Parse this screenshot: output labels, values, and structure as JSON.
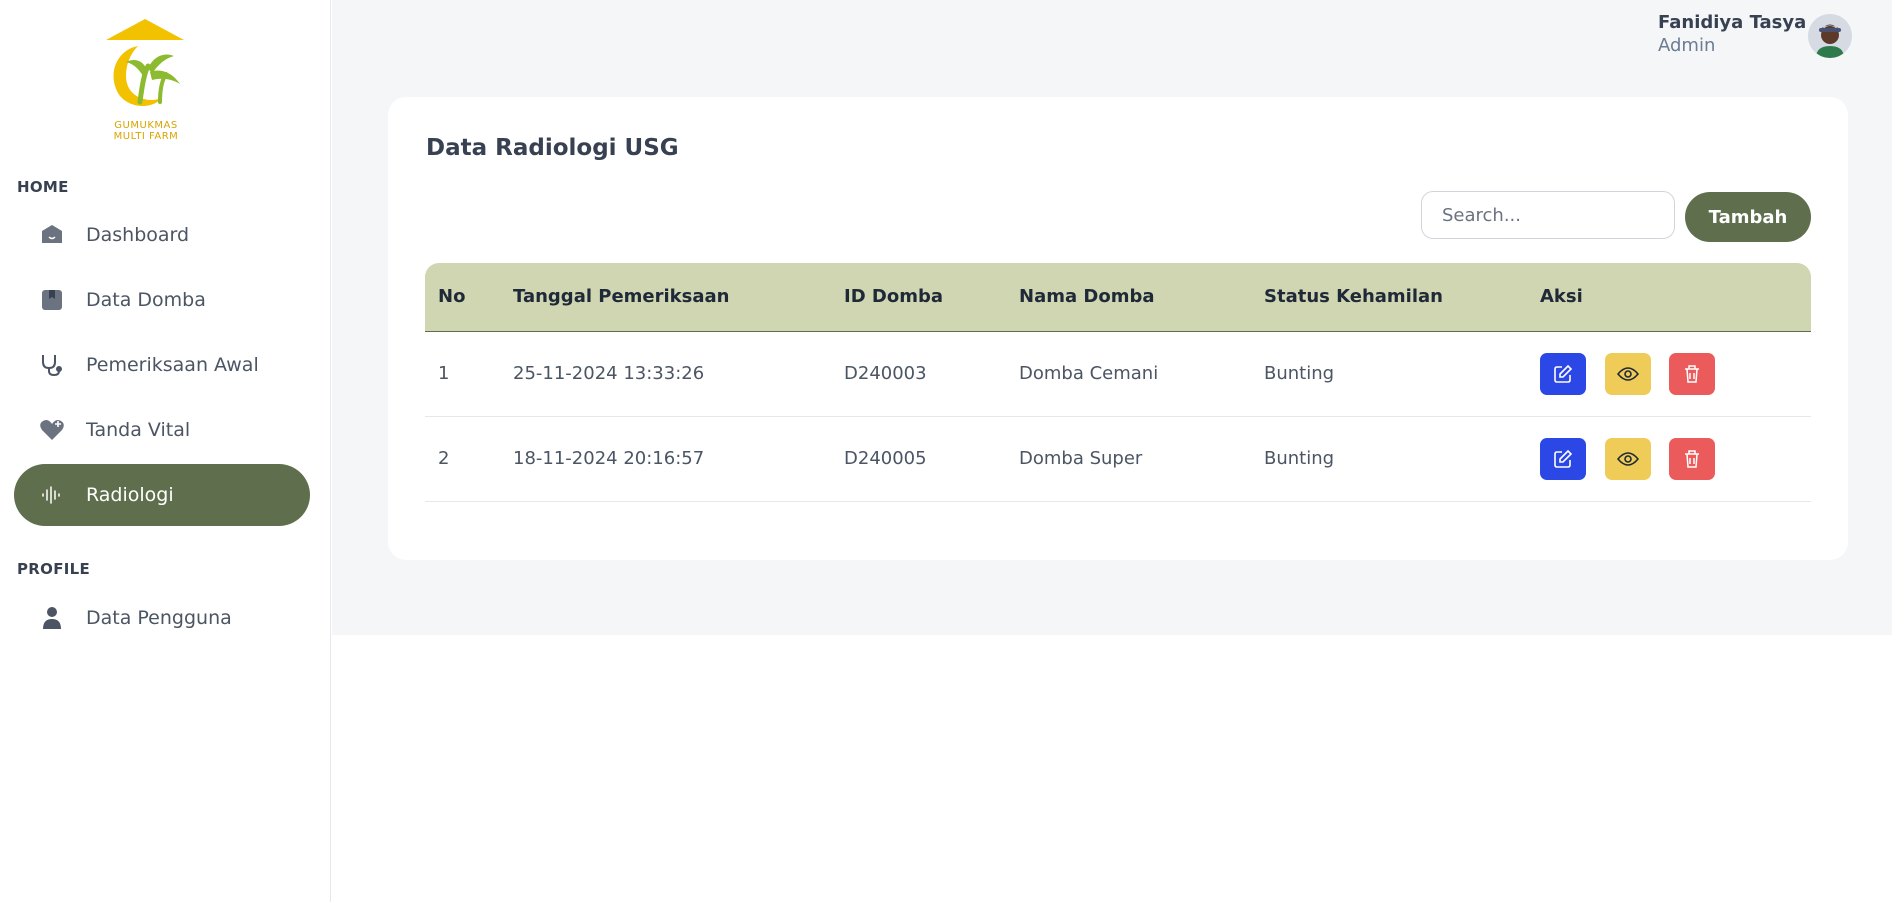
{
  "brand": {
    "logo_text_line1": "GUMUKMAS",
    "logo_text_line2": "MULTI FARM",
    "primary_color": "#5f6f4d",
    "header_color": "#cfd6b1"
  },
  "sidebar": {
    "section_home": "HOME",
    "section_profile": "PROFILE",
    "items": [
      {
        "label": "Dashboard",
        "icon": "home-icon"
      },
      {
        "label": "Data Domba",
        "icon": "bookmark-icon"
      },
      {
        "label": "Pemeriksaan Awal",
        "icon": "stethoscope-icon"
      },
      {
        "label": "Tanda Vital",
        "icon": "heart-plus-icon"
      },
      {
        "label": "Radiologi",
        "icon": "waveform-icon",
        "active": true
      }
    ],
    "profile_items": [
      {
        "label": "Data Pengguna",
        "icon": "user-icon"
      }
    ]
  },
  "user": {
    "name": "Fanidiya Tasya",
    "role": "Admin"
  },
  "card": {
    "title": "Data Radiologi USG",
    "search_placeholder": "Search...",
    "add_label": "Tambah"
  },
  "table": {
    "headers": [
      "No",
      "Tanggal Pemeriksaan",
      "ID Domba",
      "Nama Domba",
      "Status Kehamilan",
      "Aksi"
    ],
    "rows": [
      {
        "no": "1",
        "tanggal": "25-11-2024 13:33:26",
        "id": "D240003",
        "nama": "Domba Cemani",
        "status": "Bunting"
      },
      {
        "no": "2",
        "tanggal": "18-11-2024 20:16:57",
        "id": "D240005",
        "nama": "Domba Super",
        "status": "Bunting"
      }
    ],
    "actions": [
      {
        "name": "edit",
        "icon": "edit-icon",
        "color": "#2b47e6"
      },
      {
        "name": "view",
        "icon": "eye-icon",
        "color": "#efcc57"
      },
      {
        "name": "delete",
        "icon": "trash-icon",
        "color": "#ec5b5b"
      }
    ]
  }
}
